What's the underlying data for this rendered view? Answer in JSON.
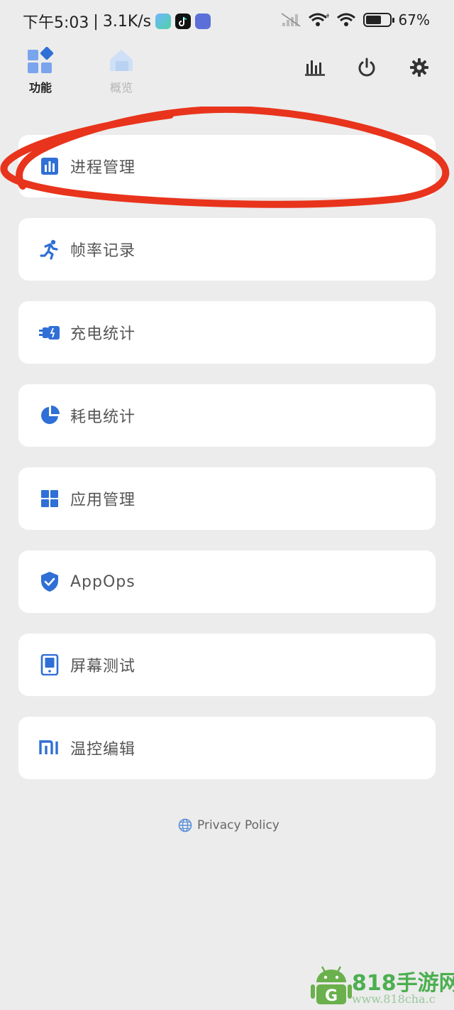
{
  "status_bar": {
    "time": "下午5:03",
    "separator": "|",
    "network_speed": "3.1K/s",
    "battery_percent": "67%",
    "battery_level": 0.67
  },
  "nav": {
    "tab_functions": "功能",
    "tab_overview": "概览",
    "accent_color": "#2f6fd6"
  },
  "menu": {
    "items": [
      {
        "label": "进程管理",
        "icon": "bar-chart-icon"
      },
      {
        "label": "帧率记录",
        "icon": "running-icon"
      },
      {
        "label": "充电统计",
        "icon": "charger-icon"
      },
      {
        "label": "耗电统计",
        "icon": "pie-chart-icon"
      },
      {
        "label": "应用管理",
        "icon": "grid-icon"
      },
      {
        "label": "AppOps",
        "icon": "shield-check-icon"
      },
      {
        "label": "屏幕测试",
        "icon": "tablet-icon"
      },
      {
        "label": "温控编辑",
        "icon": "mi-logo-icon"
      }
    ]
  },
  "footer": {
    "privacy_label": "Privacy Policy"
  },
  "annotation": {
    "color": "#e8341c"
  },
  "watermark": {
    "text": "818手游网",
    "url": "www.818cha.c"
  }
}
